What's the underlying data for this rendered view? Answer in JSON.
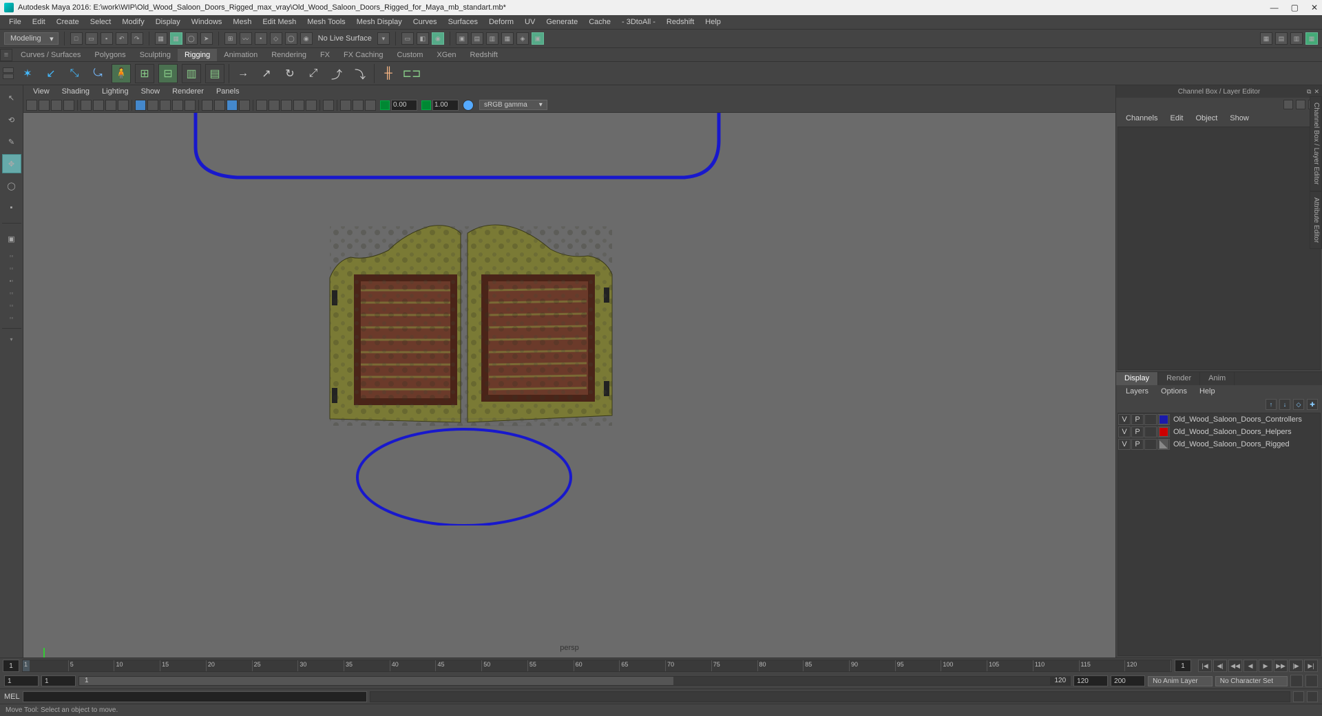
{
  "window": {
    "title": "Autodesk Maya 2016: E:\\work\\WIP\\Old_Wood_Saloon_Doors_Rigged_max_vray\\Old_Wood_Saloon_Doors_Rigged_for_Maya_mb_standart.mb*"
  },
  "main_menu": [
    "File",
    "Edit",
    "Create",
    "Select",
    "Modify",
    "Display",
    "Windows",
    "Mesh",
    "Edit Mesh",
    "Mesh Tools",
    "Mesh Display",
    "Curves",
    "Surfaces",
    "Deform",
    "UV",
    "Generate",
    "Cache",
    "  - 3DtoAll -  ",
    "Redshift",
    "Help"
  ],
  "workspace_selector": "Modeling",
  "no_live_surface": "No Live Surface",
  "shelf_tabs": [
    "Curves / Surfaces",
    "Polygons",
    "Sculpting",
    "Rigging",
    "Animation",
    "Rendering",
    "FX",
    "FX Caching",
    "Custom",
    "XGen",
    "Redshift"
  ],
  "active_shelf_tab": "Rigging",
  "viewport_menu": [
    "View",
    "Shading",
    "Lighting",
    "Show",
    "Renderer",
    "Panels"
  ],
  "vp_fields": {
    "near": "0.00",
    "far": "1.00"
  },
  "color_mgmt": "sRGB gamma",
  "persp_label": "persp",
  "channelbox": {
    "title": "Channel Box / Layer Editor",
    "menu": [
      "Channels",
      "Edit",
      "Object",
      "Show"
    ]
  },
  "layer_tabs": [
    "Display",
    "Render",
    "Anim"
  ],
  "layer_active_tab": "Display",
  "layer_menu": [
    "Layers",
    "Options",
    "Help"
  ],
  "layers": [
    {
      "v": "V",
      "p": "P",
      "color": "#1a1aaa",
      "name": "Old_Wood_Saloon_Doors_Controllers"
    },
    {
      "v": "V",
      "p": "P",
      "color": "#cc0000",
      "name": "Old_Wood_Saloon_Doors_Helpers"
    },
    {
      "v": "V",
      "p": "P",
      "color": "#888888",
      "name": "Old_Wood_Saloon_Doors_Rigged",
      "diag": true
    }
  ],
  "side_tabs": [
    "Channel Box / Layer Editor",
    "Attribute Editor"
  ],
  "timeline": {
    "start_vis": "1",
    "end_vis": "1",
    "ticks": [
      1,
      5,
      10,
      15,
      20,
      25,
      30,
      35,
      40,
      45,
      50,
      55,
      60,
      65,
      70,
      75,
      80,
      85,
      90,
      95,
      100,
      105,
      110,
      115,
      120
    ],
    "range_start": "1",
    "range_in": "1",
    "range_out": "120",
    "range_end": "200",
    "slider_label": "120",
    "slider_label_left": "1",
    "anim_layer": "No Anim Layer",
    "char_set": "No Character Set"
  },
  "cmd_label": "MEL",
  "status_text": "Move Tool: Select an object to move."
}
